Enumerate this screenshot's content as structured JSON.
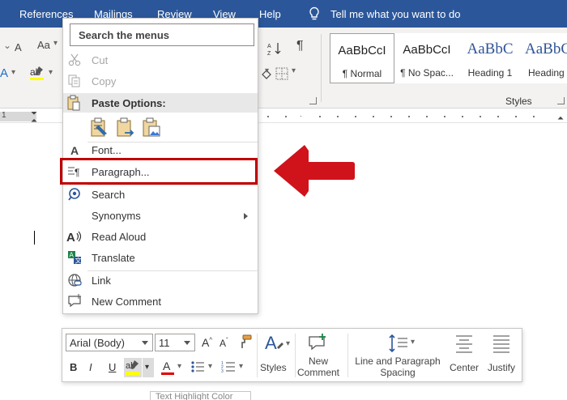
{
  "ribbon_tabs": [
    "References",
    "Mailings",
    "Review",
    "View",
    "Help"
  ],
  "tell_me": "Tell me what you want to do",
  "ribbon_font_buttons": {
    "font_size_glyph": "Aa",
    "font_color_glyph": "A"
  },
  "styles_gallery": {
    "group_label": "Styles",
    "items": [
      {
        "sample": "AaBbCcI",
        "name": "¶ Normal",
        "selected": true
      },
      {
        "sample": "AaBbCcI",
        "name": "¶ No Spac...",
        "selected": false
      },
      {
        "sample": "AaBbC",
        "name": "Heading 1",
        "selected": false
      },
      {
        "sample": "AaBbC",
        "name": "Heading",
        "selected": false
      }
    ]
  },
  "context_menu": {
    "search_placeholder": "Search the menus",
    "cut": "Cut",
    "copy": "Copy",
    "paste_options": "Paste Options:",
    "font": "Font...",
    "paragraph": "Paragraph...",
    "search": "Search",
    "synonyms": "Synonyms",
    "read_aloud": "Read Aloud",
    "translate": "Translate",
    "link": "Link",
    "new_comment": "New Comment"
  },
  "mini_toolbar": {
    "font_name": "Arial (Body)",
    "font_size": "11",
    "bold": "B",
    "italic": "I",
    "underline": "U",
    "styles_label": "Styles",
    "new_comment_line1": "New",
    "new_comment_line2": "Comment",
    "spacing_line1": "Line and Paragraph",
    "spacing_line2": "Spacing",
    "center_label": "Center",
    "justify_label": "Justify"
  },
  "tooltip_peek": "Text Highlight Color",
  "colors": {
    "ribbon_blue": "#2b579a",
    "highlight_red": "#c00000",
    "arrow_red": "#d0121b",
    "highlighter_yellow": "#ffff00",
    "font_color_red": "#e00000"
  }
}
